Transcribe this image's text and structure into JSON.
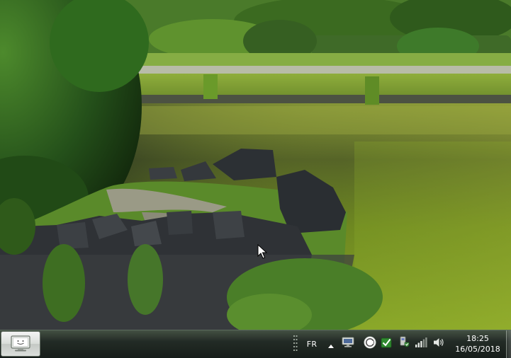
{
  "desktop": {
    "wallpaper_icon": "landscape-wallpaper",
    "colors": {
      "water": "#5f7a1e",
      "foliage": "#2f5a18",
      "grass": "#7ea53a",
      "stone_wall": "#2f3236"
    }
  },
  "taskbar": {
    "start_button_icon": "computer-monitor-icon",
    "language": "FR",
    "show_hidden_icon": "triangle-up-icon",
    "tray_icons": [
      "monitor-icon",
      "clock-app-icon",
      "green-check-icon",
      "device-shield-icon",
      "network-bars-icon",
      "speaker-icon"
    ],
    "clock": {
      "time": "18:25",
      "date": "16/05/2018"
    },
    "colors": {
      "background": "#1e2622",
      "text": "#ffffff"
    }
  }
}
